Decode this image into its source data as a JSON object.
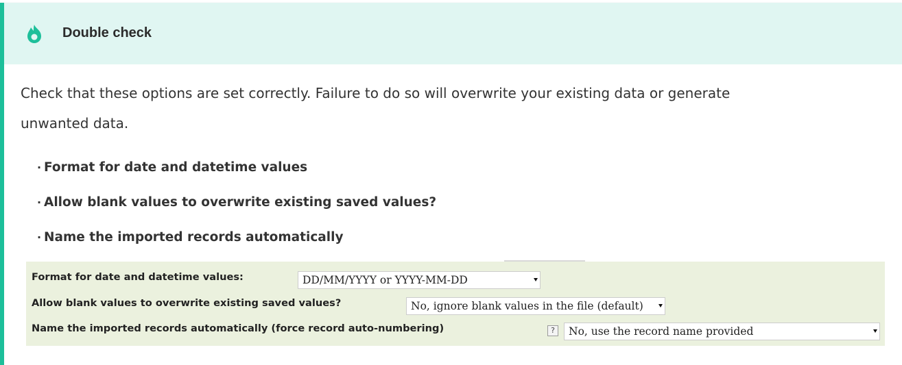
{
  "admonition": {
    "title": "Double check",
    "icon": "flame-icon",
    "accent_color": "#1dbf9a",
    "header_bg": "#e0f6f2",
    "body_line1": "Check that these options are set correctly. Failure to do so will overwrite your existing data or generate",
    "body_line2": "unwanted data.",
    "bullets": [
      "Format for date and datetime values",
      "Allow blank values to overwrite existing saved values?",
      "Name the imported records automatically"
    ]
  },
  "form": {
    "bg_color": "#ebf1de",
    "rows": [
      {
        "label": "Format for date and datetime values:",
        "selected": "DD/MM/YYYY or YYYY-MM-DD"
      },
      {
        "label": "Allow blank values to overwrite existing saved values?",
        "selected": "No, ignore blank values in the file (default)"
      },
      {
        "label": "Name the imported records automatically (force record auto-numbering)",
        "help": "?",
        "selected": "No, use the record name provided"
      }
    ]
  }
}
